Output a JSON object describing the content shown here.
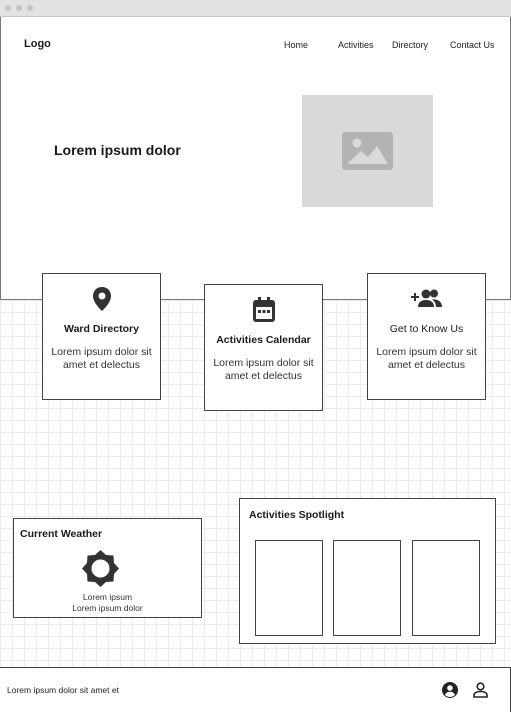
{
  "header": {
    "logo": "Logo",
    "nav": [
      "Home",
      "Activities",
      "Directory",
      "Contact Us"
    ]
  },
  "hero": {
    "title": "Lorem ipsum dolor",
    "image_icon": "image-placeholder-icon"
  },
  "cards": [
    {
      "title": "Ward Directory",
      "body": "Lorem ipsum dolor sit amet et delectus",
      "icon": "map-pin-icon"
    },
    {
      "title": "Activities Calendar",
      "body": "Lorem ipsum dolor sit amet et delectus",
      "icon": "calendar-icon"
    },
    {
      "title": "Get to Know Us",
      "body": "Lorem ipsum dolor sit amet et delectus",
      "icon": "add-group-icon"
    }
  ],
  "weather": {
    "title": "Current Weather",
    "line1": "Lorem ipsum",
    "line2": "Lorem ipsum dolor",
    "icon": "sun-icon"
  },
  "spotlight": {
    "title": "Activities Spotlight"
  },
  "footer": {
    "text": "Lorem ipsum dolor sit amet et",
    "icons": [
      "account-circle-icon",
      "person-icon"
    ]
  }
}
